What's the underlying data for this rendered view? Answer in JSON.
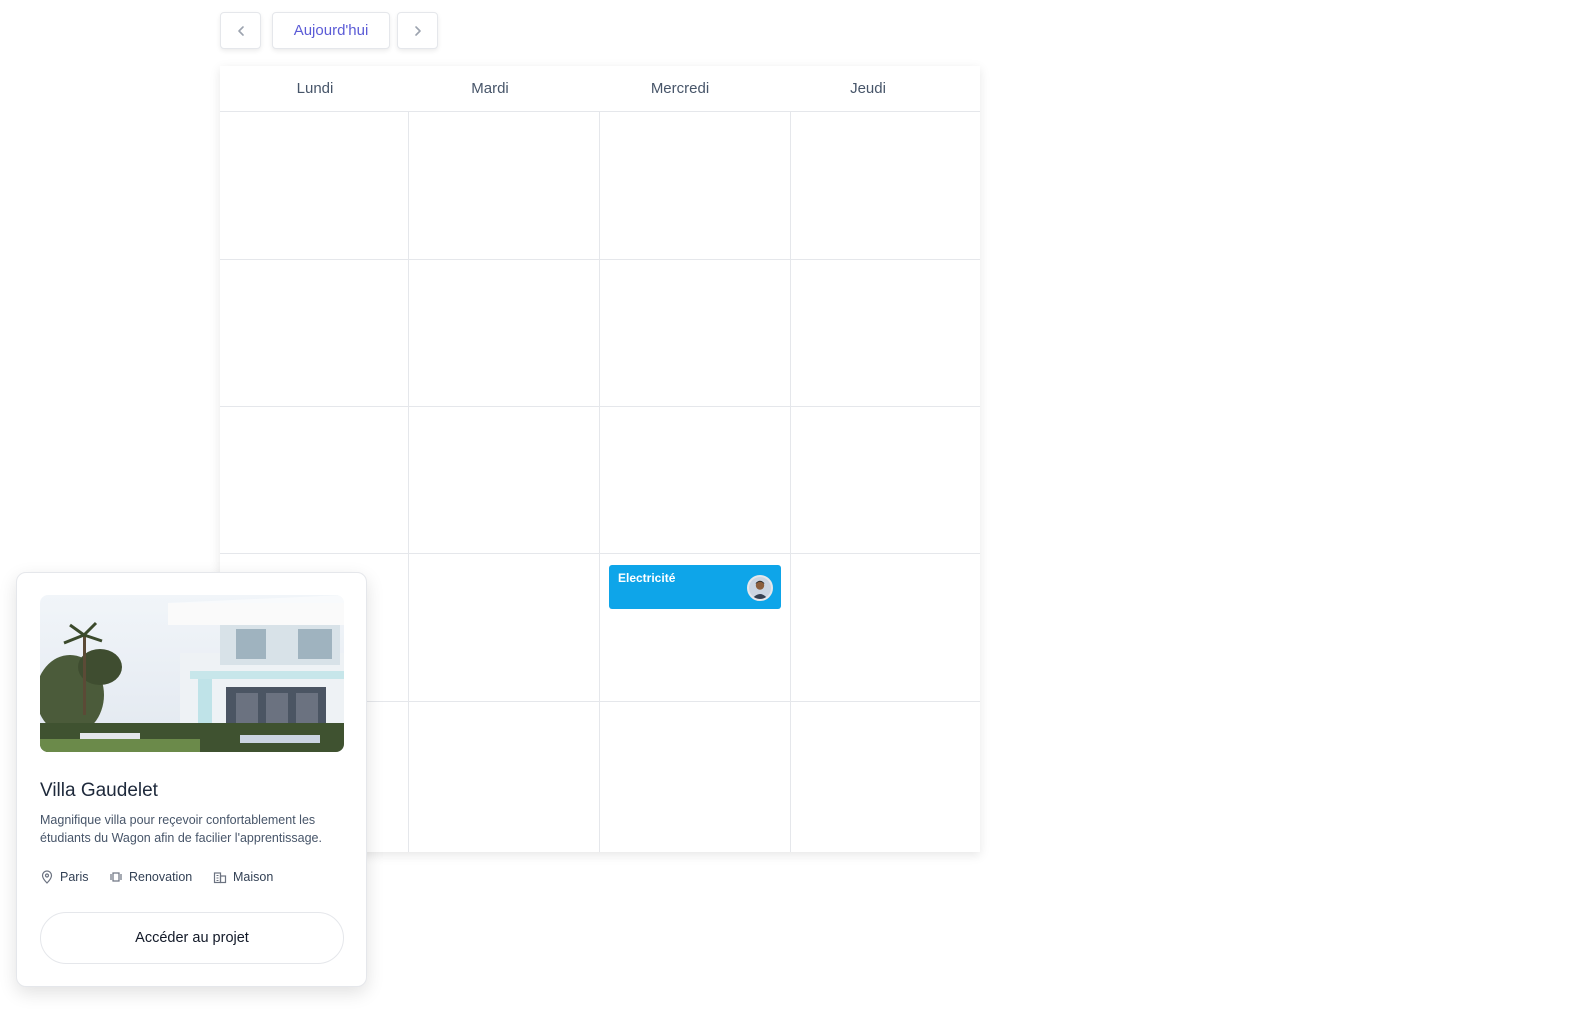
{
  "toolbar": {
    "prev_icon": "chevron-left-icon",
    "today_label": "Aujourd'hui",
    "next_icon": "chevron-right-icon",
    "accent": "#5b5bd6"
  },
  "calendar": {
    "days": [
      "Lundi",
      "Mardi",
      "Mercredi",
      "Jeudi"
    ],
    "event": {
      "title": "Electricité",
      "day": "Mercredi",
      "color": "#0ea5e9",
      "avatar_icon": "avatar-icon"
    }
  },
  "card": {
    "title": "Villa Gaudelet",
    "description": "Magnifique villa pour reçevoir confortablement les étudiants du Wagon afin de facilier l'apprentissage.",
    "location": "Paris",
    "category": "Renovation",
    "type": "Maison",
    "button_label": "Accéder au projet"
  }
}
